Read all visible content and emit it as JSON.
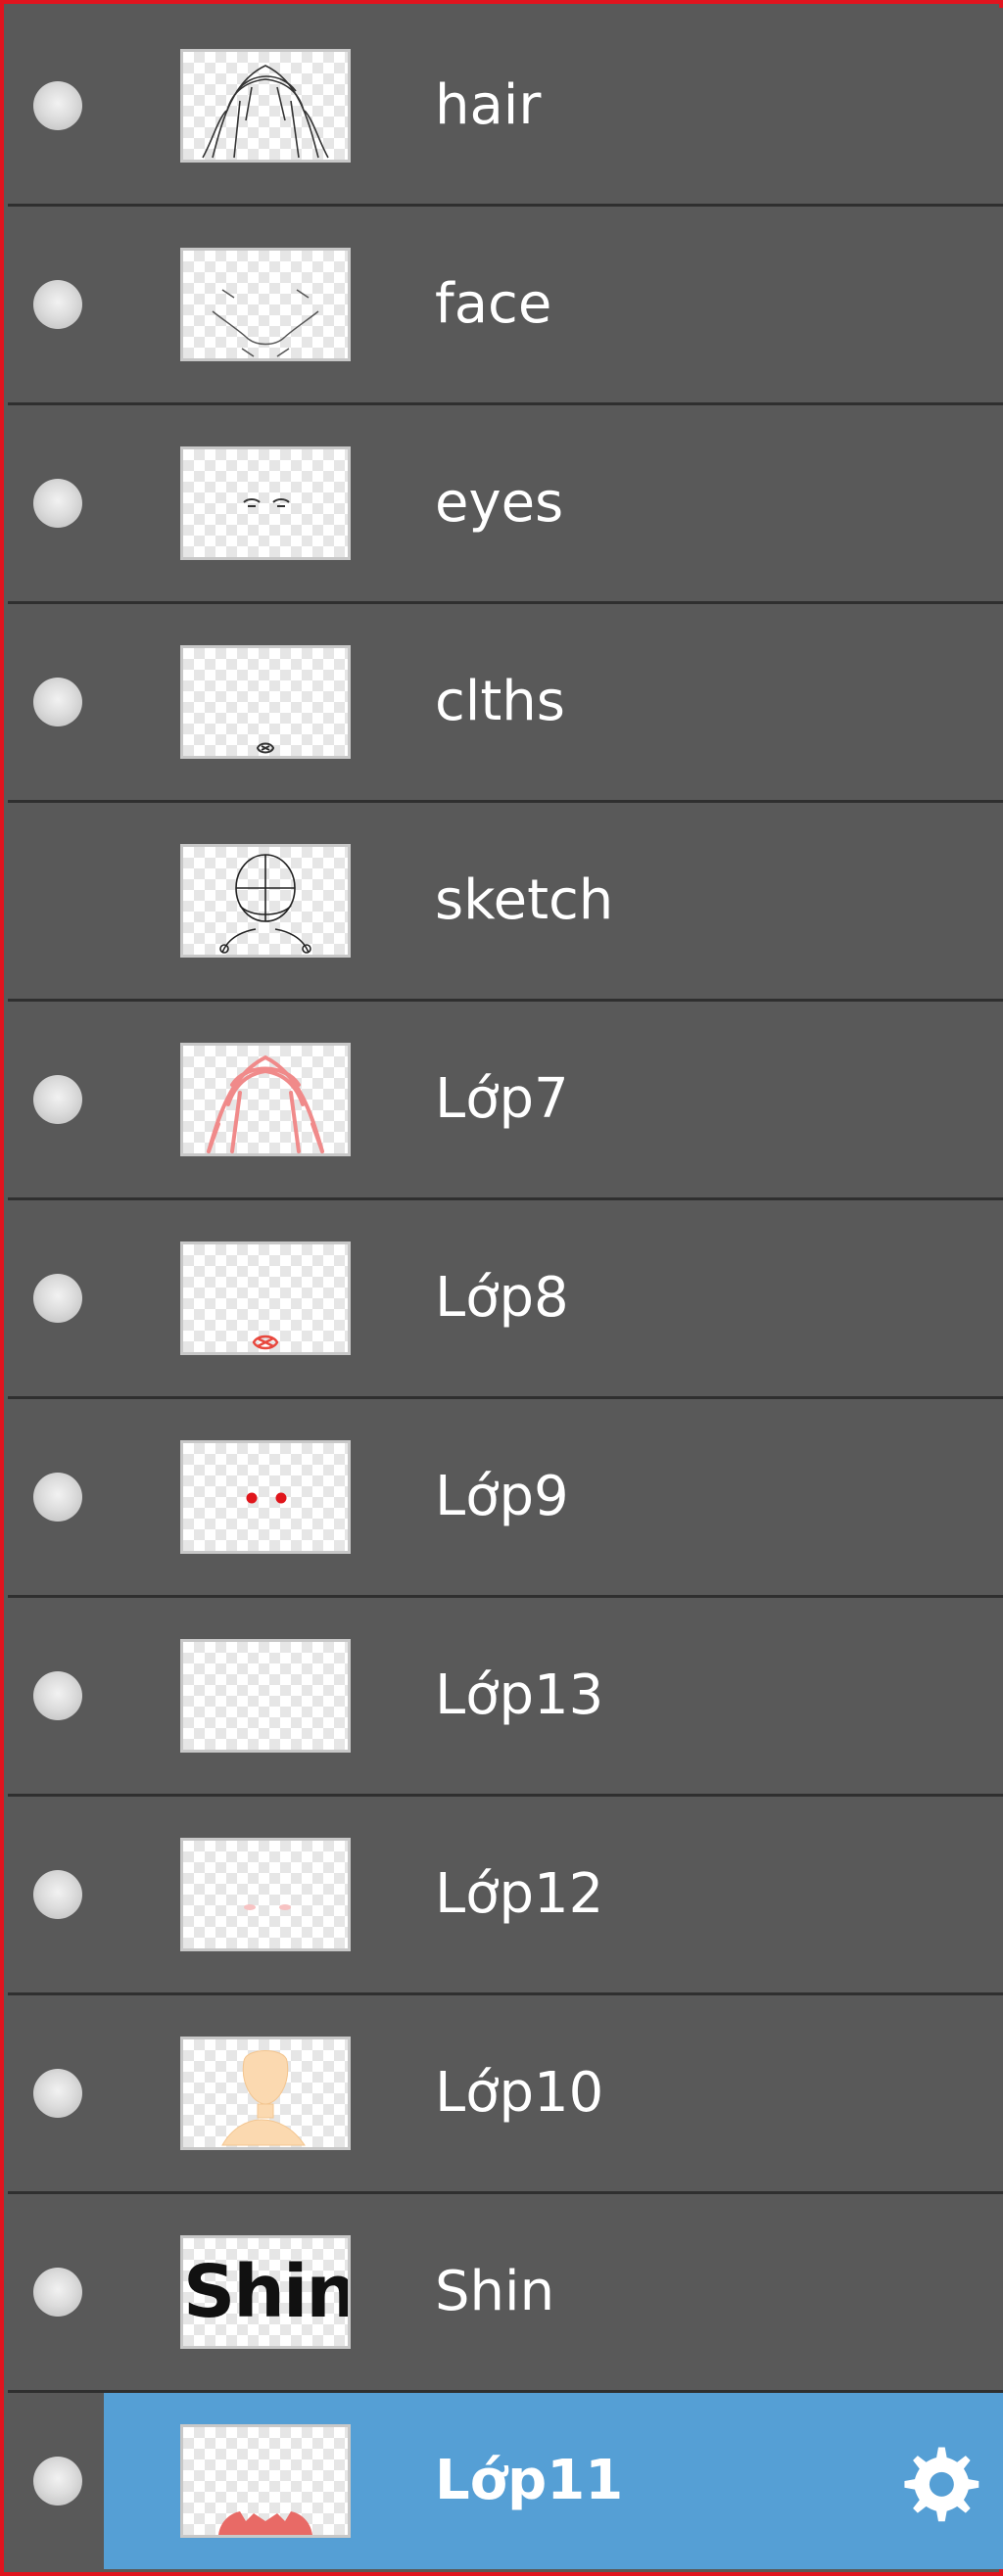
{
  "layers_panel": {
    "layers": [
      {
        "name": "hair",
        "visible": true,
        "selected": false,
        "thumb": "hair-sketch"
      },
      {
        "name": "face",
        "visible": true,
        "selected": false,
        "thumb": "face-sketch"
      },
      {
        "name": "eyes",
        "visible": true,
        "selected": false,
        "thumb": "eyes-sketch"
      },
      {
        "name": "clths",
        "visible": true,
        "selected": false,
        "thumb": "clothes-sketch"
      },
      {
        "name": "sketch",
        "visible": false,
        "selected": false,
        "thumb": "head-guide-sketch"
      },
      {
        "name": "Lớp7",
        "visible": true,
        "selected": false,
        "thumb": "pink-hair"
      },
      {
        "name": "Lớp8",
        "visible": true,
        "selected": false,
        "thumb": "red-bow"
      },
      {
        "name": "Lớp9",
        "visible": true,
        "selected": false,
        "thumb": "red-eyes"
      },
      {
        "name": "Lớp13",
        "visible": true,
        "selected": false,
        "thumb": "empty"
      },
      {
        "name": "Lớp12",
        "visible": true,
        "selected": false,
        "thumb": "faint-blush"
      },
      {
        "name": "Lớp10",
        "visible": true,
        "selected": false,
        "thumb": "skin-tone"
      },
      {
        "name": "Shin",
        "visible": true,
        "selected": false,
        "thumb": "text",
        "thumb_text": "Shin"
      },
      {
        "name": "Lớp11",
        "visible": true,
        "selected": true,
        "thumb": "red-clothes",
        "settings_icon": "gear-icon"
      }
    ]
  },
  "colors": {
    "panel_bg": "#595959",
    "separator": "#2f2f2f",
    "selected_bg": "#559fd5",
    "border": "#e0141e",
    "text": "#ffffff"
  }
}
